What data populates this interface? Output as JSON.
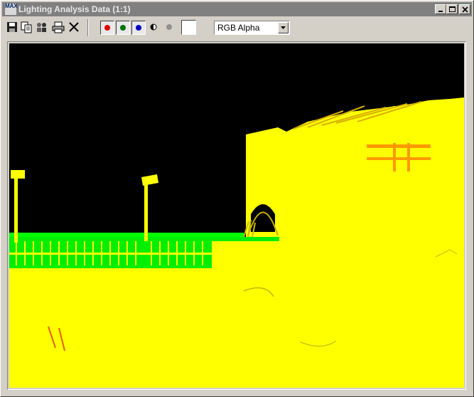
{
  "window": {
    "title": "Lighting Analysis Data (1:1)",
    "app_icon_text": "MAX"
  },
  "toolbar": {
    "buttons": [
      "save-icon",
      "clone-icon",
      "multi-user-icon",
      "print-icon",
      "clear-icon"
    ],
    "channels": [
      {
        "name": "red-channel",
        "color": "#e00000",
        "pressed": true
      },
      {
        "name": "green-channel",
        "color": "#007000",
        "pressed": true
      },
      {
        "name": "blue-channel",
        "color": "#0000c0",
        "pressed": true
      }
    ],
    "mono_icon": "monochrome-icon",
    "alpha_icon": "alpha-icon",
    "swatch_color": "#ffffff",
    "channel_select": {
      "value": "RGB Alpha"
    }
  },
  "render": {
    "sky_color": "#000000",
    "ground_color": "#ffff00",
    "fence_color": "#00ff00",
    "highlight_color": "#ff9900"
  }
}
